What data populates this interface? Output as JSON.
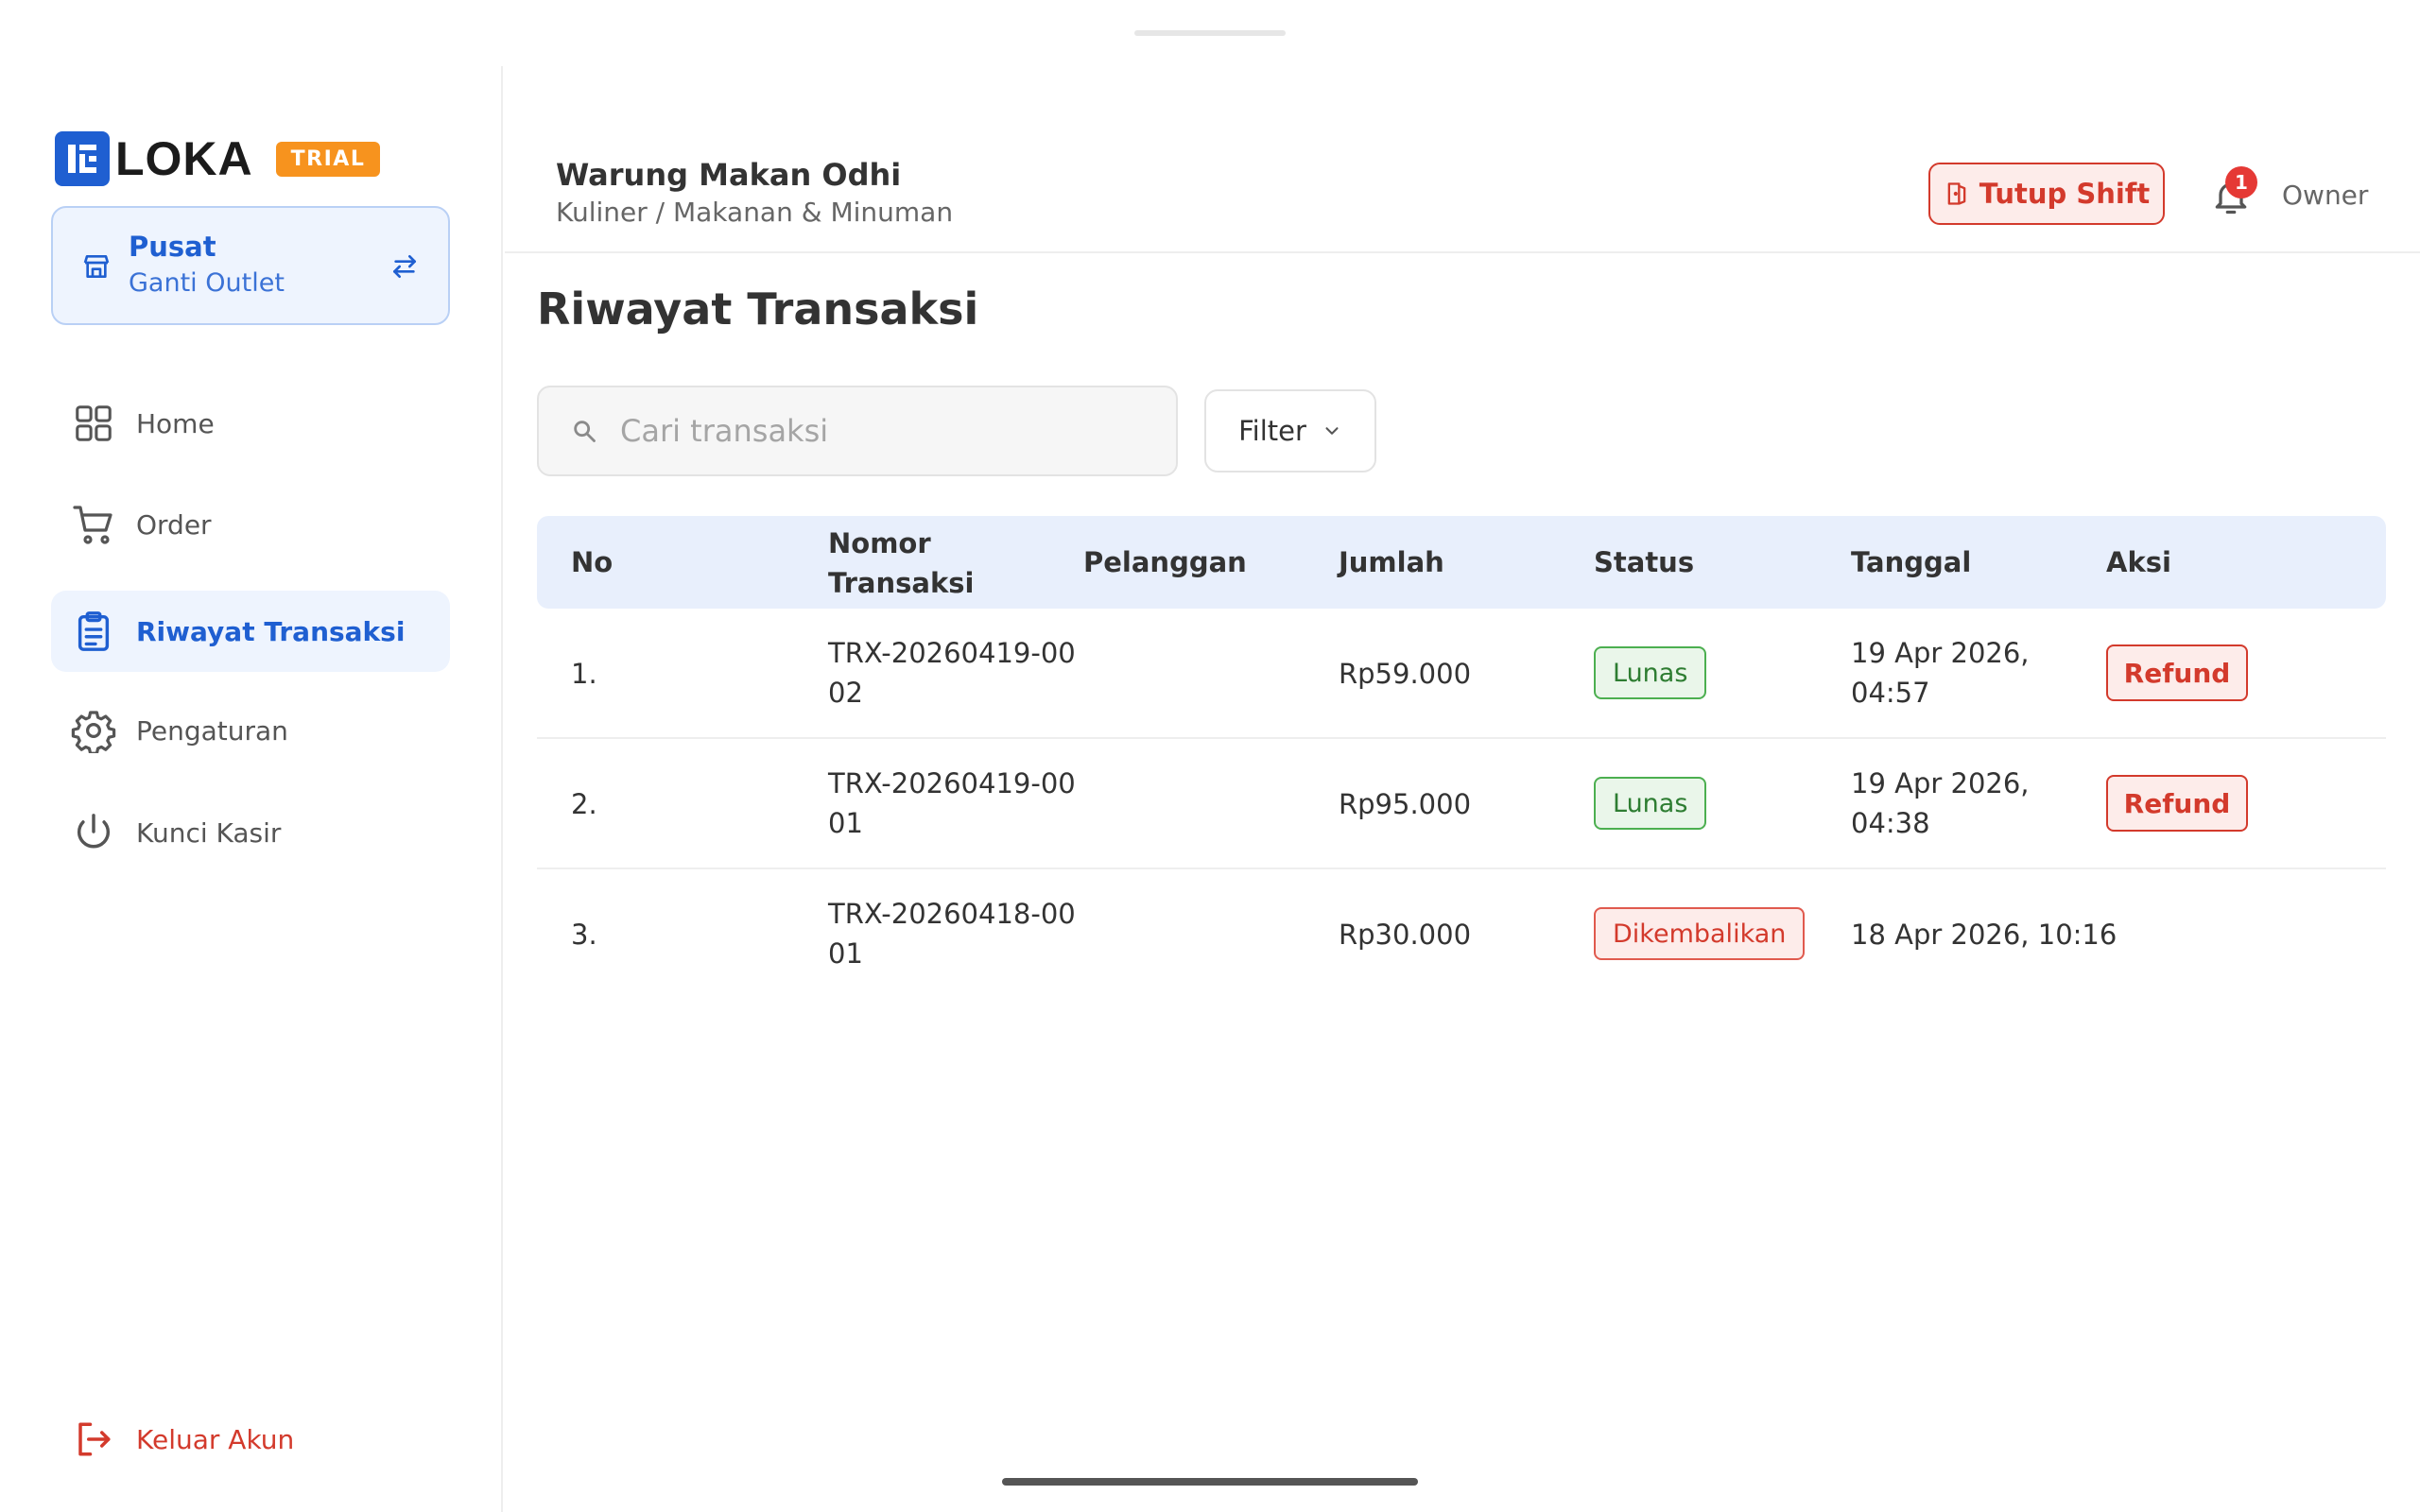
{
  "brand": {
    "logo_text": "LOKA",
    "badge": "TRIAL",
    "color": "#1f5fd1"
  },
  "outlet": {
    "name": "Pusat",
    "action": "Ganti Outlet"
  },
  "sidebar": {
    "items": [
      {
        "label": "Home",
        "icon": "grid-icon"
      },
      {
        "label": "Order",
        "icon": "cart-icon"
      },
      {
        "label": "Riwayat Transaksi",
        "icon": "clipboard-icon",
        "active": true
      },
      {
        "label": "Pengaturan",
        "icon": "gear-icon"
      },
      {
        "label": "Kunci Kasir",
        "icon": "power-icon"
      }
    ],
    "logout": {
      "label": "Keluar Akun",
      "icon": "logout-icon"
    }
  },
  "header": {
    "store_name": "Warung Makan Odhi",
    "store_category": "Kuliner / Makanan & Minuman",
    "close_shift_label": "Tutup Shift",
    "notification_count": "1",
    "user_role": "Owner"
  },
  "page": {
    "title": "Riwayat Transaksi",
    "search_placeholder": "Cari transaksi",
    "filter_label": "Filter"
  },
  "table": {
    "columns": {
      "no": "No",
      "nomor_line1": "Nomor",
      "nomor_line2": "Transaksi",
      "pelanggan": "Pelanggan",
      "jumlah": "Jumlah",
      "status": "Status",
      "tanggal": "Tanggal",
      "aksi": "Aksi"
    },
    "rows": [
      {
        "no": "1.",
        "trx": "TRX-20260419-0002",
        "customer": "",
        "amount": "Rp59.000",
        "status": "Lunas",
        "date_line1": "19 Apr 2026,",
        "date_line2": "04:57",
        "action": "Refund"
      },
      {
        "no": "2.",
        "trx": "TRX-20260419-0001",
        "customer": "",
        "amount": "Rp95.000",
        "status": "Lunas",
        "date_line1": "19 Apr 2026,",
        "date_line2": "04:38",
        "action": "Refund"
      },
      {
        "no": "3.",
        "trx": "TRX-20260418-0001",
        "customer": "",
        "amount": "Rp30.000",
        "status": "Dikembalikan",
        "date": "18 Apr 2026, 10:16"
      }
    ]
  },
  "colors": {
    "primary": "#1f5fd1",
    "danger": "#d33a2c",
    "success": "#2e7d32",
    "trial": "#f7931e",
    "table_header_bg": "#e8effc"
  }
}
